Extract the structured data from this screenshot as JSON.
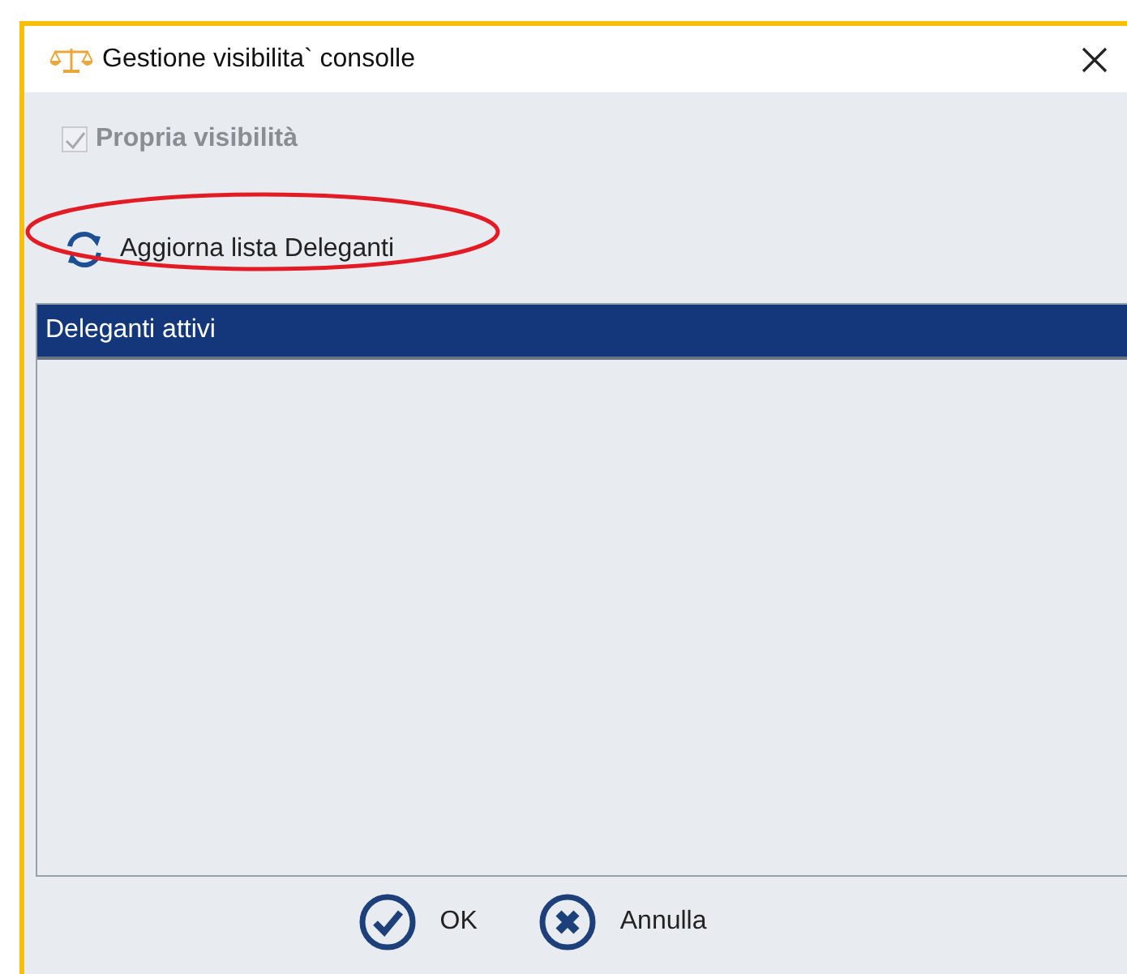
{
  "window": {
    "title": "Gestione visibilita` consolle"
  },
  "visibility_checkbox": {
    "label": "Propria visibilità",
    "checked": true,
    "disabled": true
  },
  "refresh_button": {
    "label": "Aggiorna lista Deleganti",
    "highlighted": true
  },
  "list": {
    "header": "Deleganti attivi"
  },
  "buttons": [
    {
      "kind": "ok",
      "label": "OK"
    },
    {
      "kind": "cancel",
      "label": "Annulla"
    }
  ]
}
